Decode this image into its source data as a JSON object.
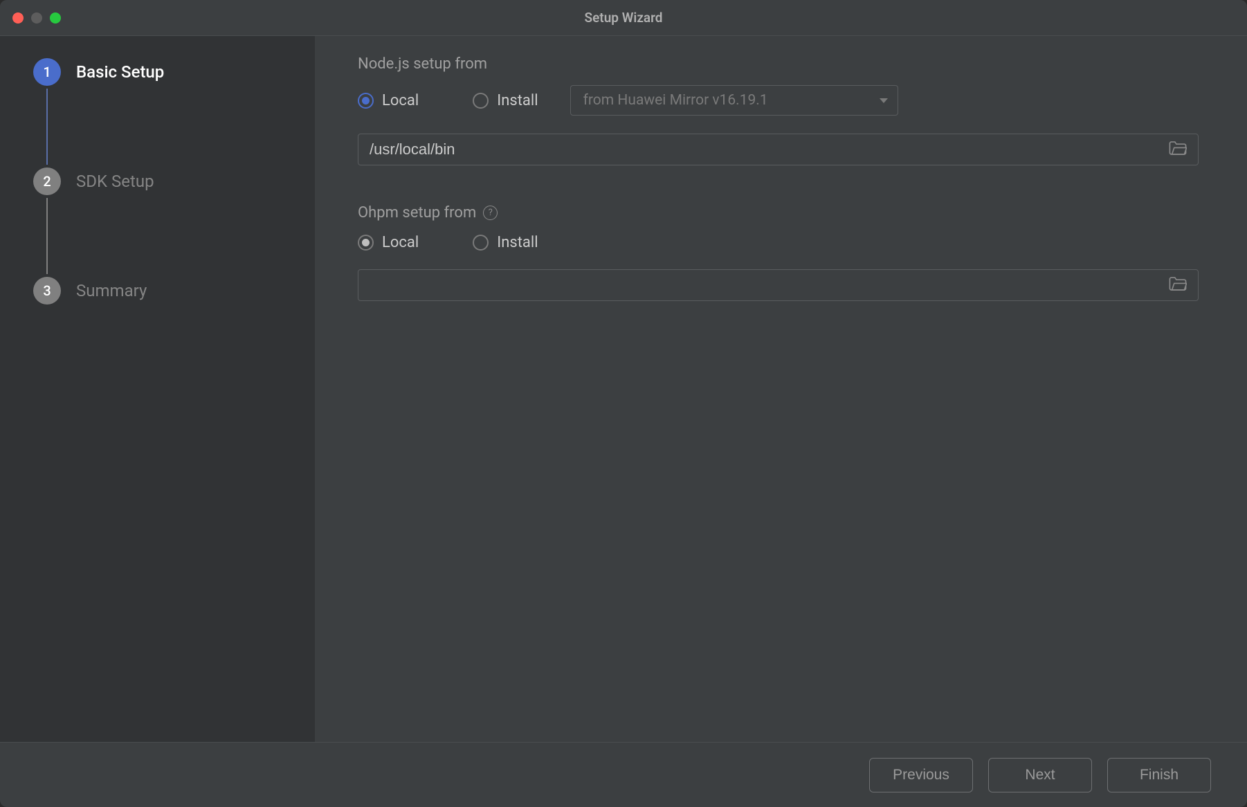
{
  "window": {
    "title": "Setup Wizard"
  },
  "sidebar": {
    "steps": [
      {
        "num": "1",
        "label": "Basic Setup"
      },
      {
        "num": "2",
        "label": "SDK Setup"
      },
      {
        "num": "3",
        "label": "Summary"
      }
    ]
  },
  "main": {
    "nodejs": {
      "title": "Node.js setup from",
      "radio_local": "Local",
      "radio_install": "Install",
      "install_source": "from Huawei Mirror v16.19.1",
      "path": "/usr/local/bin"
    },
    "ohpm": {
      "title": "Ohpm setup from",
      "radio_local": "Local",
      "radio_install": "Install",
      "path": ""
    }
  },
  "footer": {
    "previous": "Previous",
    "next": "Next",
    "finish": "Finish"
  }
}
